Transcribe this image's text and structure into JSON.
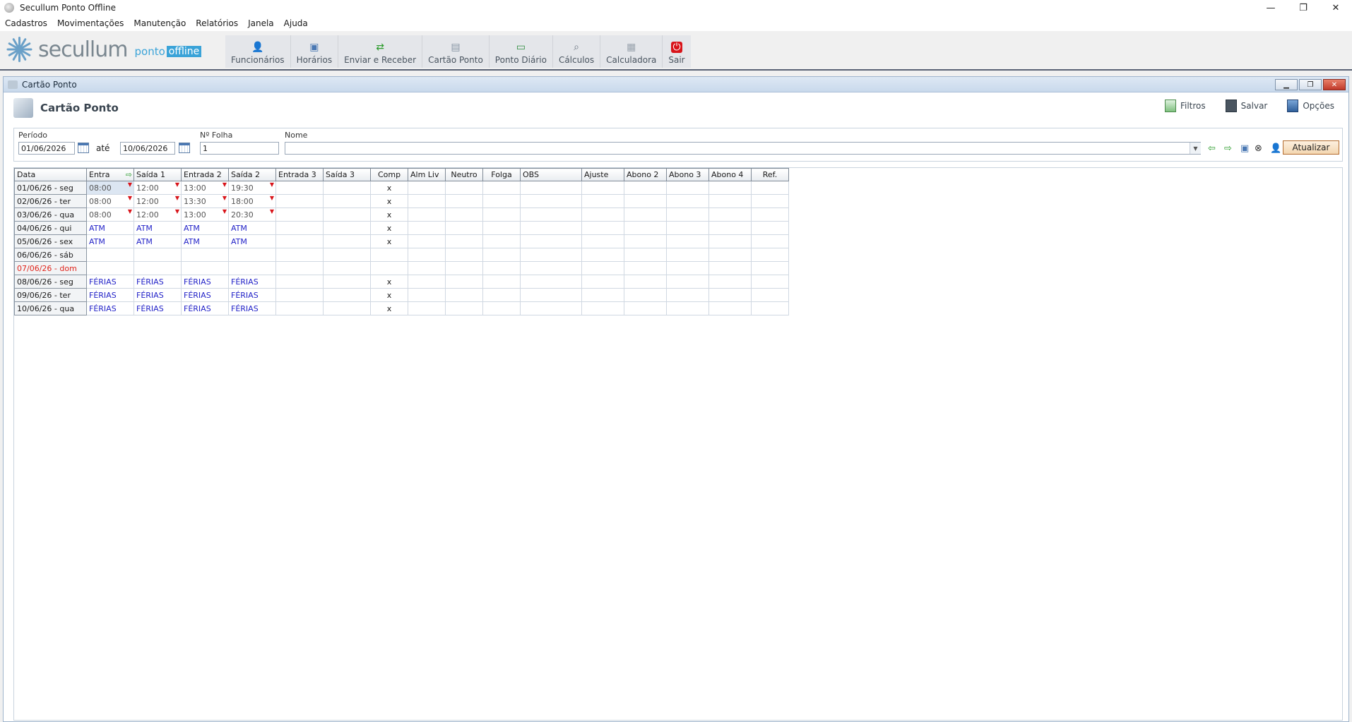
{
  "window": {
    "title": "Secullum Ponto Offline",
    "controls": [
      "—",
      "❐",
      "✕"
    ]
  },
  "menu": [
    "Cadastros",
    "Movimentações",
    "Manutenção",
    "Relatórios",
    "Janela",
    "Ajuda"
  ],
  "logo": {
    "word": "secullum",
    "ponto": "ponto",
    "offline": "offline"
  },
  "toolbar": [
    {
      "label": "Funcionários",
      "icon": "employees-icon"
    },
    {
      "label": "Horários",
      "icon": "schedule-icon"
    },
    {
      "label": "Enviar e Receber",
      "icon": "send-receive-icon"
    },
    {
      "label": "Cartão Ponto",
      "icon": "timecard-icon"
    },
    {
      "label": "Ponto Diário",
      "icon": "daily-icon"
    },
    {
      "label": "Cálculos",
      "icon": "calculations-icon"
    },
    {
      "label": "Calculadora",
      "icon": "calculator-icon"
    },
    {
      "label": "Sair",
      "icon": "exit-icon"
    }
  ],
  "child": {
    "title": "Cartão Ponto",
    "heading": "Cartão Ponto",
    "actions": {
      "filtros": "Filtros",
      "salvar": "Salvar",
      "opcoes": "Opções"
    }
  },
  "filters": {
    "periodo_label": "Período",
    "date_from": "01/06/2026",
    "ate_label": "até",
    "date_to": "10/06/2026",
    "folha_label": "Nº Folha",
    "folha_value": "1",
    "nome_label": "Nome",
    "nome_value": "",
    "atualizar": "Atualizar"
  },
  "grid": {
    "columns": [
      "Data",
      "Entra",
      "Saída 1",
      "Entrada 2",
      "Saída 2",
      "Entrada 3",
      "Saída 3",
      "Comp",
      "Alm Liv",
      "Neutro",
      "Folga",
      "OBS",
      "Ajuste",
      "Abono 2",
      "Abono 3",
      "Abono 4",
      "Ref."
    ],
    "rows": [
      {
        "date": "01/06/26 - seg",
        "cells": [
          "08:00",
          "12:00",
          "13:00",
          "19:30",
          "",
          "",
          "x"
        ],
        "kind": "time",
        "flags": [
          true,
          true,
          true,
          true
        ]
      },
      {
        "date": "02/06/26 - ter",
        "cells": [
          "08:00",
          "12:00",
          "13:30",
          "18:00",
          "",
          "",
          "x"
        ],
        "kind": "time",
        "flags": [
          true,
          true,
          true,
          true
        ]
      },
      {
        "date": "03/06/26 - qua",
        "cells": [
          "08:00",
          "12:00",
          "13:00",
          "20:30",
          "",
          "",
          "x"
        ],
        "kind": "time",
        "flags": [
          true,
          true,
          true,
          true
        ]
      },
      {
        "date": "04/06/26 - qui",
        "cells": [
          "ATM",
          "ATM",
          "ATM",
          "ATM",
          "",
          "",
          "x"
        ],
        "kind": "blue",
        "flags": [
          false,
          false,
          false,
          false
        ]
      },
      {
        "date": "05/06/26 - sex",
        "cells": [
          "ATM",
          "ATM",
          "ATM",
          "ATM",
          "",
          "",
          "x"
        ],
        "kind": "blue",
        "flags": [
          false,
          false,
          false,
          false
        ]
      },
      {
        "date": "06/06/26 - sáb",
        "cells": [
          "",
          "",
          "",
          "",
          "",
          "",
          ""
        ],
        "kind": "blue",
        "flags": [
          false,
          false,
          false,
          false
        ]
      },
      {
        "date": "07/06/26 - dom",
        "cells": [
          "",
          "",
          "",
          "",
          "",
          "",
          ""
        ],
        "kind": "sunday",
        "flags": [
          false,
          false,
          false,
          false
        ]
      },
      {
        "date": "08/06/26 - seg",
        "cells": [
          "FÉRIAS",
          "FÉRIAS",
          "FÉRIAS",
          "FÉRIAS",
          "",
          "",
          "x"
        ],
        "kind": "blue",
        "flags": [
          false,
          false,
          false,
          false
        ]
      },
      {
        "date": "09/06/26 - ter",
        "cells": [
          "FÉRIAS",
          "FÉRIAS",
          "FÉRIAS",
          "FÉRIAS",
          "",
          "",
          "x"
        ],
        "kind": "blue",
        "flags": [
          false,
          false,
          false,
          false
        ]
      },
      {
        "date": "10/06/26 - qua",
        "cells": [
          "FÉRIAS",
          "FÉRIAS",
          "FÉRIAS",
          "FÉRIAS",
          "",
          "",
          "x"
        ],
        "kind": "blue",
        "flags": [
          false,
          false,
          false,
          false
        ]
      }
    ]
  },
  "colors": {
    "accent": "#3aa3d8",
    "sunday": "#e0241b",
    "blue_text": "#2323c8",
    "flag": "#d8141a"
  }
}
